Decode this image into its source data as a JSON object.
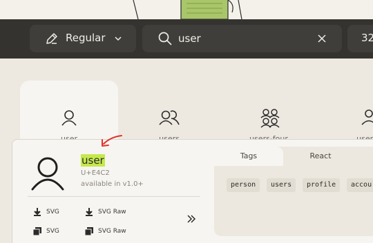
{
  "toolbar": {
    "weight_label": "Regular",
    "search_value": "user",
    "search_placeholder": "",
    "size_value": "32"
  },
  "grid": [
    {
      "label": "user"
    },
    {
      "label": "users"
    },
    {
      "label": "users-four"
    },
    {
      "label": "users-"
    }
  ],
  "details": {
    "name_highlight": "user",
    "code": "U+E4C2",
    "available": "available in v1.0+",
    "downloads": [
      {
        "label": "SVG"
      },
      {
        "label": "SVG Raw"
      },
      {
        "label": "SVG"
      },
      {
        "label": "SVG Raw"
      }
    ],
    "tabs": [
      {
        "label": "Tags"
      },
      {
        "label": "React"
      }
    ],
    "tags": [
      "person",
      "users",
      "profile",
      "accou"
    ]
  },
  "colors": {
    "toolbar_bg": "#35332f",
    "highlight": "#c5e84d",
    "annotation_arrow": "#e0322b"
  }
}
